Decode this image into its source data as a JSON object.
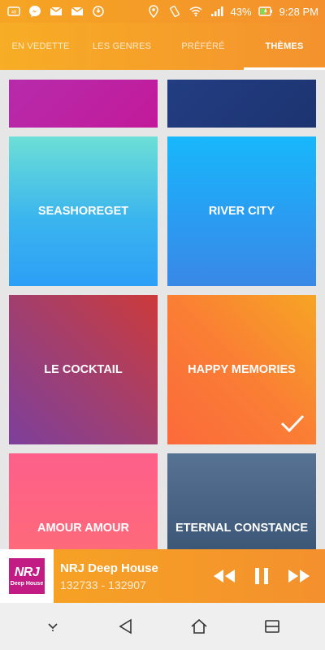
{
  "status": {
    "battery": "43%",
    "time": "9:28 PM",
    "icons": [
      "tv-icon",
      "messenger-icon",
      "gmail-icon",
      "gmail-icon",
      "sync-icon",
      "location-icon",
      "vibrate-icon",
      "wifi-icon",
      "signal-icon",
      "battery-icon"
    ]
  },
  "tabs": [
    {
      "label": "EN VEDETTE",
      "active": false
    },
    {
      "label": "LES GENRES",
      "active": false
    },
    {
      "label": "PRÉFÉRÉ",
      "active": false
    },
    {
      "label": "THÈMES",
      "active": true
    }
  ],
  "themes": [
    {
      "label": ""
    },
    {
      "label": ""
    },
    {
      "label": "SEASHOREGET"
    },
    {
      "label": "RIVER CITY"
    },
    {
      "label": "LE COCKTAIL"
    },
    {
      "label": "HAPPY MEMORIES",
      "selected": true
    },
    {
      "label": "AMOUR AMOUR"
    },
    {
      "label": "ETERNAL CONSTANCE"
    }
  ],
  "player": {
    "logo_text": "NRJ",
    "logo_sub": "Deep House",
    "title": "NRJ Deep House",
    "subtitle": "132733 - 132907",
    "controls": [
      "rewind-icon",
      "pause-icon",
      "fast-forward-icon"
    ]
  },
  "colors": {
    "accent": "#f5a023",
    "selected_tile": "#fa7e34"
  }
}
